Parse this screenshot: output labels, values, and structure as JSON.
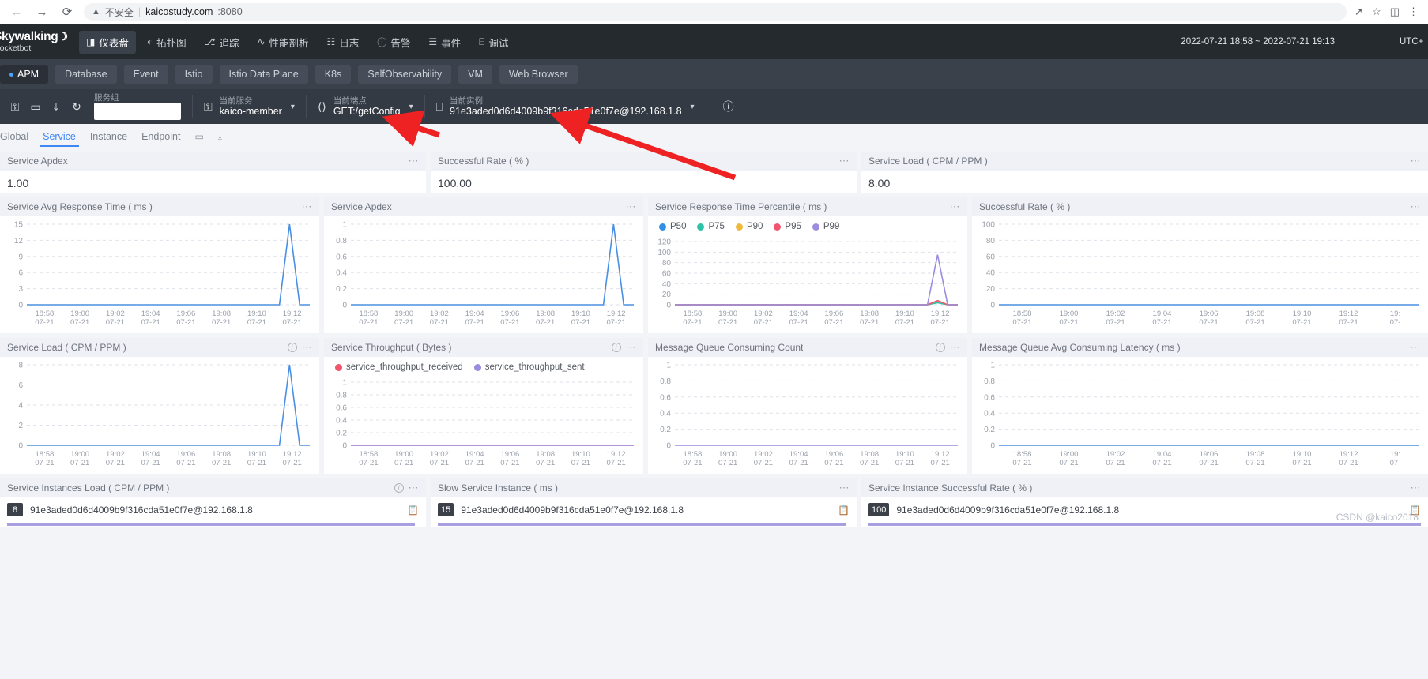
{
  "browser": {
    "back_icon": "arrow-left-icon",
    "forward_icon": "arrow-right-icon",
    "reload_icon": "reload-icon",
    "warning_icon": "warning-triangle-icon",
    "security_label": "不安全",
    "divider": "|",
    "url_host": "kaicostudy.com",
    "url_port": ":8080",
    "share_icon": "share-icon",
    "star_icon": "star-icon",
    "sidepanel_icon": "side-panel-icon",
    "menu_icon": "more-menu-icon"
  },
  "topnav": {
    "logo_line1": "Skywalking",
    "logo_moon": "☽",
    "logo_line2": "Rocketbot",
    "items": [
      {
        "label": "仪表盘",
        "icon": "dashboard-icon",
        "glyph": "◨",
        "active": true
      },
      {
        "label": "拓扑图",
        "icon": "topology-icon",
        "glyph": "◐",
        "active": false
      },
      {
        "label": "追踪",
        "icon": "trace-icon",
        "glyph": "⎇",
        "active": false
      },
      {
        "label": "性能剖析",
        "icon": "profiling-icon",
        "glyph": "∿",
        "active": false
      },
      {
        "label": "日志",
        "icon": "log-icon",
        "glyph": "☷",
        "active": false
      },
      {
        "label": "告警",
        "icon": "alarm-icon",
        "glyph": "ⓘ",
        "active": false
      },
      {
        "label": "事件",
        "icon": "event-icon",
        "glyph": "☰",
        "active": false
      },
      {
        "label": "调试",
        "icon": "debug-icon",
        "glyph": "⌸",
        "active": false
      }
    ],
    "time_range": "2022-07-21 18:58 ~ 2022-07-21 19:13",
    "timezone": "UTC+"
  },
  "dashboard_tabs": [
    {
      "label": "APM",
      "active": true,
      "dot": true
    },
    {
      "label": "Database",
      "active": false,
      "dot": false
    },
    {
      "label": "Event",
      "active": false,
      "dot": false
    },
    {
      "label": "Istio",
      "active": false,
      "dot": false
    },
    {
      "label": "Istio Data Plane",
      "active": false,
      "dot": false
    },
    {
      "label": "K8s",
      "active": false,
      "dot": false
    },
    {
      "label": "SelfObservability",
      "active": false,
      "dot": false
    },
    {
      "label": "VM",
      "active": false,
      "dot": false
    },
    {
      "label": "Web Browser",
      "active": false,
      "dot": false
    }
  ],
  "selector": {
    "tools": [
      {
        "icon": "lock-icon",
        "glyph": "⚿"
      },
      {
        "icon": "folder-icon",
        "glyph": "▭"
      },
      {
        "icon": "download-icon",
        "glyph": "⤓"
      },
      {
        "icon": "refresh-icon",
        "glyph": "↻"
      }
    ],
    "service_group_label": "服务组",
    "service_group_value": "",
    "service_group_placeholder": "",
    "current_service_label": "当前服务",
    "current_service_value": "kaico-member",
    "current_service_icon": "service-icon",
    "current_endpoint_label": "当前端点",
    "current_endpoint_value": "GET:/getConfig",
    "current_endpoint_icon": "code-brackets-icon",
    "current_instance_label": "当前实例",
    "current_instance_value": "91e3aded0d6d4009b9f316cda51e0f7e@192.168.1.8",
    "current_instance_icon": "instance-laptop-icon",
    "info_icon": "info-circle-icon",
    "caret_icon": "chevron-down-icon"
  },
  "sub_nav": {
    "items": [
      {
        "label": "Global",
        "active": false
      },
      {
        "label": "Service",
        "active": true
      },
      {
        "label": "Instance",
        "active": false
      },
      {
        "label": "Endpoint",
        "active": false
      }
    ],
    "icons": [
      {
        "icon": "folder-icon",
        "glyph": "▭"
      },
      {
        "icon": "download-icon",
        "glyph": "⤓"
      }
    ]
  },
  "number_cards": [
    {
      "title": "Service Apdex",
      "value": "1.00",
      "menu_icon": "more-dots-icon",
      "has_info": false
    },
    {
      "title": "Successful Rate ( % )",
      "value": "100.00",
      "menu_icon": "more-dots-icon",
      "has_info": false
    },
    {
      "title": "Service Load ( CPM / PPM )",
      "value": "8.00",
      "menu_icon": "more-dots-icon",
      "has_info": false
    }
  ],
  "instance_cards": [
    {
      "title": "Service Instances Load ( CPM / PPM )",
      "has_info": true,
      "badge": "8",
      "instance": "91e3aded0d6d4009b9f316cda51e0f7e@192.168.1.8",
      "bar_pct": 100,
      "copy_icon": "copy-icon"
    },
    {
      "title": "Slow Service Instance ( ms )",
      "has_info": false,
      "badge": "15",
      "instance": "91e3aded0d6d4009b9f316cda51e0f7e@192.168.1.8",
      "bar_pct": 100,
      "copy_icon": "copy-icon"
    },
    {
      "title": "Service Instance Successful Rate ( % )",
      "has_info": false,
      "badge": "100",
      "instance": "91e3aded0d6d4009b9f316cda51e0f7e@192.168.1.8",
      "bar_pct": 100,
      "copy_icon": "copy-icon"
    }
  ],
  "chart_data": [
    {
      "id": "service-avg-response-time",
      "type": "line",
      "title": "Service Avg Response Time ( ms )",
      "has_info": false,
      "xlabel": "",
      "ylabel": "",
      "ylim": [
        0,
        15
      ],
      "yticks": [
        "15",
        "12",
        "9",
        "6",
        "3",
        "0"
      ],
      "grid": true,
      "legend": [],
      "xticks_time": [
        "18:58",
        "19:00",
        "19:02",
        "19:04",
        "19:06",
        "19:08",
        "19:10",
        "19:12"
      ],
      "xticks_date": [
        "07-21",
        "07-21",
        "07-21",
        "07-21",
        "07-21",
        "07-21",
        "07-21",
        "07-21"
      ],
      "series": [
        {
          "name": "avg_response_time",
          "color": "#4a90e2",
          "values": [
            0,
            0,
            0,
            0,
            0,
            0,
            0,
            0,
            0,
            0,
            0,
            0,
            0,
            0,
            0,
            0,
            0,
            0,
            0,
            0,
            0,
            0,
            0,
            0,
            0,
            0,
            15,
            0,
            0
          ]
        }
      ]
    },
    {
      "id": "service-apdex",
      "type": "line",
      "title": "Service Apdex",
      "has_info": false,
      "ylim": [
        0,
        1
      ],
      "yticks": [
        "1",
        "0.8",
        "0.6",
        "0.4",
        "0.2",
        "0"
      ],
      "grid": true,
      "legend": [],
      "xticks_time": [
        "18:58",
        "19:00",
        "19:02",
        "19:04",
        "19:06",
        "19:08",
        "19:10",
        "19:12"
      ],
      "xticks_date": [
        "07-21",
        "07-21",
        "07-21",
        "07-21",
        "07-21",
        "07-21",
        "07-21",
        "07-21"
      ],
      "series": [
        {
          "name": "apdex",
          "color": "#4a90e2",
          "values": [
            0,
            0,
            0,
            0,
            0,
            0,
            0,
            0,
            0,
            0,
            0,
            0,
            0,
            0,
            0,
            0,
            0,
            0,
            0,
            0,
            0,
            0,
            0,
            0,
            0,
            0,
            1,
            0,
            0
          ]
        }
      ]
    },
    {
      "id": "service-response-time-percentile",
      "type": "line",
      "title": "Service Response Time Percentile ( ms )",
      "has_info": false,
      "ylim": [
        0,
        120
      ],
      "yticks": [
        "120",
        "100",
        "80",
        "60",
        "40",
        "20",
        "0"
      ],
      "grid": true,
      "legend": [
        {
          "name": "P50",
          "color": "#338fe5"
        },
        {
          "name": "P75",
          "color": "#2fc2a8"
        },
        {
          "name": "P90",
          "color": "#f0b93a"
        },
        {
          "name": "P95",
          "color": "#f0556d"
        },
        {
          "name": "P99",
          "color": "#9b8ce0"
        }
      ],
      "xticks_time": [
        "18:58",
        "19:00",
        "19:02",
        "19:04",
        "19:06",
        "19:08",
        "19:10",
        "19:12"
      ],
      "xticks_date": [
        "07-21",
        "07-21",
        "07-21",
        "07-21",
        "07-21",
        "07-21",
        "07-21",
        "07-21"
      ],
      "series": [
        {
          "name": "P50",
          "color": "#338fe5",
          "values": [
            0,
            0,
            0,
            0,
            0,
            0,
            0,
            0,
            0,
            0,
            0,
            0,
            0,
            0,
            0,
            0,
            0,
            0,
            0,
            0,
            0,
            0,
            0,
            0,
            0,
            0,
            4,
            0,
            0
          ]
        },
        {
          "name": "P75",
          "color": "#2fc2a8",
          "values": [
            0,
            0,
            0,
            0,
            0,
            0,
            0,
            0,
            0,
            0,
            0,
            0,
            0,
            0,
            0,
            0,
            0,
            0,
            0,
            0,
            0,
            0,
            0,
            0,
            0,
            0,
            4,
            0,
            0
          ]
        },
        {
          "name": "P90",
          "color": "#f0b93a",
          "values": [
            0,
            0,
            0,
            0,
            0,
            0,
            0,
            0,
            0,
            0,
            0,
            0,
            0,
            0,
            0,
            0,
            0,
            0,
            0,
            0,
            0,
            0,
            0,
            0,
            0,
            0,
            8,
            0,
            0
          ]
        },
        {
          "name": "P95",
          "color": "#f0556d",
          "values": [
            0,
            0,
            0,
            0,
            0,
            0,
            0,
            0,
            0,
            0,
            0,
            0,
            0,
            0,
            0,
            0,
            0,
            0,
            0,
            0,
            0,
            0,
            0,
            0,
            0,
            0,
            8,
            0,
            0
          ]
        },
        {
          "name": "P99",
          "color": "#9b8ce0",
          "values": [
            0,
            0,
            0,
            0,
            0,
            0,
            0,
            0,
            0,
            0,
            0,
            0,
            0,
            0,
            0,
            0,
            0,
            0,
            0,
            0,
            0,
            0,
            0,
            0,
            0,
            0,
            95,
            0,
            0
          ]
        }
      ]
    },
    {
      "id": "successful-rate",
      "type": "line",
      "title": "Successful Rate ( % )",
      "has_info": false,
      "ylim": [
        0,
        100
      ],
      "yticks": [
        "100",
        "80",
        "60",
        "40",
        "20",
        "0"
      ],
      "grid": true,
      "legend": [],
      "xticks_time": [
        "18:58",
        "19:00",
        "19:02",
        "19:04",
        "19:06",
        "19:08",
        "19:10",
        "19:12",
        "19:"
      ],
      "xticks_date": [
        "07-21",
        "07-21",
        "07-21",
        "07-21",
        "07-21",
        "07-21",
        "07-21",
        "07-21",
        "07-"
      ],
      "series": [
        {
          "name": "successful_rate",
          "color": "#4a90e2",
          "values": [
            0,
            0,
            0,
            0,
            0,
            0,
            0,
            0,
            0,
            0,
            0,
            0,
            0,
            0,
            0,
            0,
            0,
            0,
            0,
            0,
            0,
            0,
            0,
            0,
            0,
            0,
            0,
            0,
            0
          ]
        }
      ]
    },
    {
      "id": "service-load",
      "type": "line",
      "title": "Service Load ( CPM / PPM )",
      "has_info": true,
      "ylim": [
        0,
        8
      ],
      "yticks": [
        "8",
        "6",
        "4",
        "2",
        "0"
      ],
      "grid": true,
      "legend": [],
      "xticks_time": [
        "18:58",
        "19:00",
        "19:02",
        "19:04",
        "19:06",
        "19:08",
        "19:10",
        "19:12"
      ],
      "xticks_date": [
        "07-21",
        "07-21",
        "07-21",
        "07-21",
        "07-21",
        "07-21",
        "07-21",
        "07-21"
      ],
      "series": [
        {
          "name": "service_load",
          "color": "#4a90e2",
          "values": [
            0,
            0,
            0,
            0,
            0,
            0,
            0,
            0,
            0,
            0,
            0,
            0,
            0,
            0,
            0,
            0,
            0,
            0,
            0,
            0,
            0,
            0,
            0,
            0,
            0,
            0,
            8,
            0,
            0
          ]
        }
      ]
    },
    {
      "id": "service-throughput",
      "type": "line",
      "title": "Service Throughput ( Bytes )",
      "has_info": true,
      "ylim": [
        0,
        1
      ],
      "yticks": [
        "1",
        "0.8",
        "0.6",
        "0.4",
        "0.2",
        "0"
      ],
      "grid": true,
      "legend": [
        {
          "name": "service_throughput_received",
          "color": "#f0556d"
        },
        {
          "name": "service_throughput_sent",
          "color": "#9b8ce0"
        }
      ],
      "xticks_time": [
        "18:58",
        "19:00",
        "19:02",
        "19:04",
        "19:06",
        "19:08",
        "19:10",
        "19:12"
      ],
      "xticks_date": [
        "07-21",
        "07-21",
        "07-21",
        "07-21",
        "07-21",
        "07-21",
        "07-21",
        "07-21"
      ],
      "series": [
        {
          "name": "service_throughput_received",
          "color": "#f0556d",
          "values": [
            0,
            0,
            0,
            0,
            0,
            0,
            0,
            0,
            0,
            0,
            0,
            0,
            0,
            0,
            0,
            0,
            0,
            0,
            0,
            0,
            0,
            0,
            0,
            0,
            0,
            0,
            0,
            0,
            0
          ]
        },
        {
          "name": "service_throughput_sent",
          "color": "#9b8ce0",
          "values": [
            0,
            0,
            0,
            0,
            0,
            0,
            0,
            0,
            0,
            0,
            0,
            0,
            0,
            0,
            0,
            0,
            0,
            0,
            0,
            0,
            0,
            0,
            0,
            0,
            0,
            0,
            0,
            0,
            0
          ]
        }
      ]
    },
    {
      "id": "message-queue-consuming-count",
      "type": "line",
      "title": "Message Queue Consuming Count",
      "has_info": true,
      "ylim": [
        0,
        1
      ],
      "yticks": [
        "1",
        "0.8",
        "0.6",
        "0.4",
        "0.2",
        "0"
      ],
      "grid": true,
      "legend": [],
      "xticks_time": [
        "18:58",
        "19:00",
        "19:02",
        "19:04",
        "19:06",
        "19:08",
        "19:10",
        "19:12"
      ],
      "xticks_date": [
        "07-21",
        "07-21",
        "07-21",
        "07-21",
        "07-21",
        "07-21",
        "07-21",
        "07-21"
      ],
      "series": [
        {
          "name": "consuming_count",
          "color": "#9b8ce0",
          "values": [
            0,
            0,
            0,
            0,
            0,
            0,
            0,
            0,
            0,
            0,
            0,
            0,
            0,
            0,
            0,
            0,
            0,
            0,
            0,
            0,
            0,
            0,
            0,
            0,
            0,
            0,
            0,
            0,
            0
          ]
        }
      ]
    },
    {
      "id": "message-queue-avg-consuming-latency",
      "type": "line",
      "title": "Message Queue Avg Consuming Latency ( ms )",
      "has_info": false,
      "ylim": [
        0,
        1
      ],
      "yticks": [
        "1",
        "0.8",
        "0.6",
        "0.4",
        "0.2",
        "0"
      ],
      "grid": true,
      "legend": [],
      "xticks_time": [
        "18:58",
        "19:00",
        "19:02",
        "19:04",
        "19:06",
        "19:08",
        "19:10",
        "19:12",
        "19:"
      ],
      "xticks_date": [
        "07-21",
        "07-21",
        "07-21",
        "07-21",
        "07-21",
        "07-21",
        "07-21",
        "07-21",
        "07-"
      ],
      "series": [
        {
          "name": "avg_consuming_latency",
          "color": "#4a90e2",
          "values": [
            0,
            0,
            0,
            0,
            0,
            0,
            0,
            0,
            0,
            0,
            0,
            0,
            0,
            0,
            0,
            0,
            0,
            0,
            0,
            0,
            0,
            0,
            0,
            0,
            0,
            0,
            0,
            0,
            0
          ]
        }
      ]
    }
  ],
  "watermark": "CSDN @kaico2018",
  "colors": {
    "accent": "#3f87f5",
    "line_blue": "#4a90e2",
    "purple": "#9b8ce0",
    "nav_dark": "#252a2f",
    "tab_bg": "#3a414b",
    "selector_bg": "#343a44"
  }
}
